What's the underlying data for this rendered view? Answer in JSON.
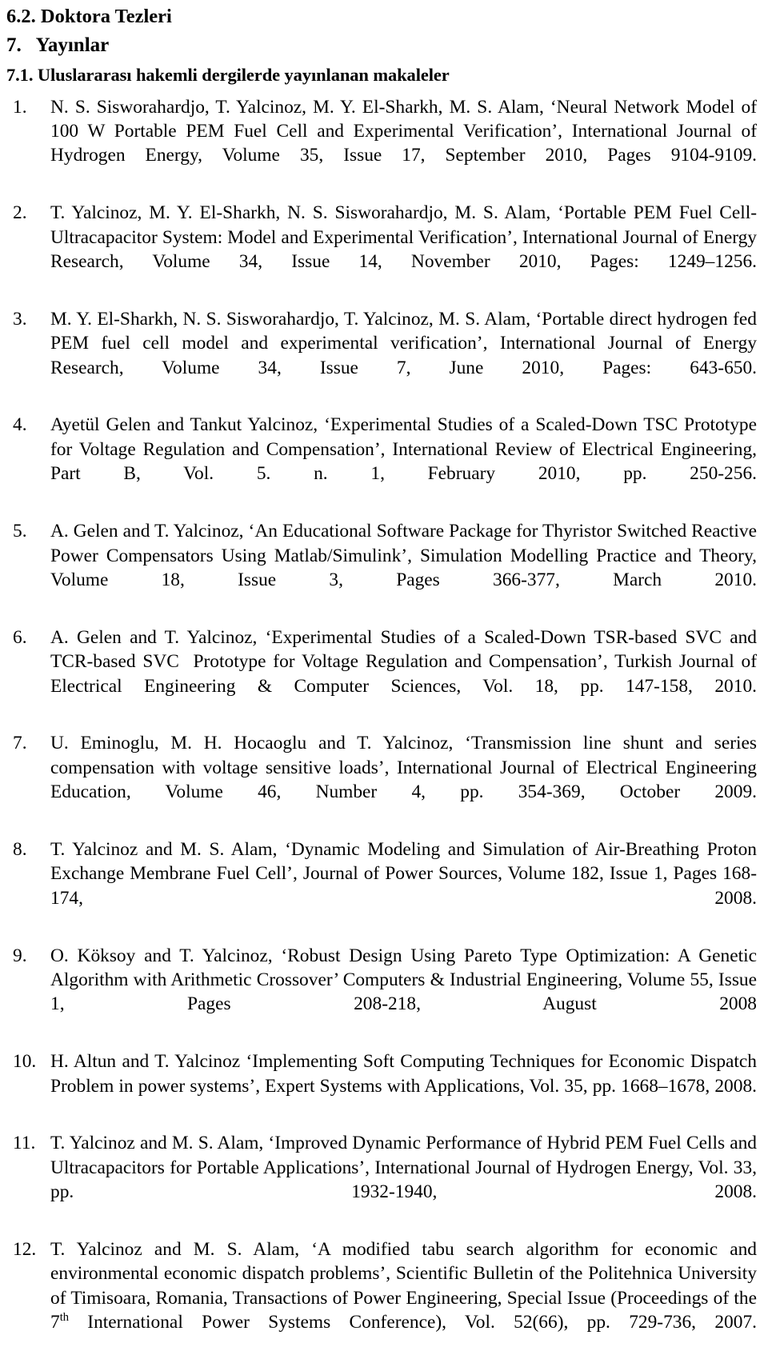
{
  "document": {
    "headings": {
      "section_6_2": "6.2. Doktora Tezleri",
      "section_7": "7.   Yayınlar",
      "section_7_1": "7.1. Uluslararası hakemli dergilerde yayınlanan makaleler"
    },
    "references": [
      {
        "number": "1.",
        "text": "N. S. Sisworahardjo, T. Yalcinoz, M. Y. El-Sharkh, M. S. Alam, ‘Neural Network Model of 100 W Portable PEM Fuel Cell and Experimental Verification’, International Journal of Hydrogen Energy, Volume 35, Issue 17, September 2010, Pages 9104-9109."
      },
      {
        "number": "2.",
        "text": "T. Yalcinoz, M. Y. El-Sharkh, N. S. Sisworahardjo, M. S. Alam, ‘Portable PEM Fuel Cell-Ultracapacitor System: Model and Experimental Verification’, International Journal of Energy Research, Volume 34, Issue 14, November 2010, Pages: 1249–1256."
      },
      {
        "number": "3.",
        "text": "M. Y. El-Sharkh, N. S. Sisworahardjo, T. Yalcinoz, M. S. Alam, ‘Portable direct hydrogen fed PEM fuel cell model and experimental verification’, International Journal of Energy Research, Volume 34, Issue 7, June 2010, Pages: 643-650."
      },
      {
        "number": "4.",
        "text": "Ayetül Gelen and Tankut Yalcinoz, ‘Experimental Studies of a Scaled-Down TSC Prototype for Voltage Regulation and Compensation’, International Review of Electrical Engineering, Part B, Vol. 5. n. 1, February 2010, pp. 250-256."
      },
      {
        "number": "5.",
        "text": "A. Gelen and T. Yalcinoz, ‘An Educational Software Package for Thyristor Switched Reactive Power Compensators Using Matlab/Simulink’, Simulation Modelling Practice and Theory, Volume 18, Issue 3, Pages 366-377, March 2010."
      },
      {
        "number": "6.",
        "text": "A. Gelen and T. Yalcinoz, ‘Experimental Studies of a Scaled-Down TSR-based SVC and TCR-based SVC  Prototype for Voltage Regulation and Compensation’, Turkish Journal of Electrical Engineering & Computer Sciences, Vol. 18, pp. 147-158, 2010."
      },
      {
        "number": "7.",
        "text": "U. Eminoglu, M. H. Hocaoglu and T. Yalcinoz, ‘Transmission line shunt and series compensation with voltage sensitive loads’, International Journal of Electrical Engineering Education, Volume 46, Number 4, pp. 354-369, October 2009."
      },
      {
        "number": "8.",
        "text": "T. Yalcinoz and M. S. Alam, ‘Dynamic Modeling and Simulation of Air-Breathing Proton Exchange Membrane Fuel Cell’, Journal of Power Sources, Volume 182, Issue 1, Pages 168-174, 2008."
      },
      {
        "number": "9.",
        "text": "O. Köksoy and T. Yalcinoz, ‘Robust Design Using Pareto Type Optimization: A Genetic Algorithm with Arithmetic Crossover’ Computers & Industrial Engineering, Volume 55, Issue 1, Pages 208-218, August 2008"
      },
      {
        "number": "10.",
        "text": "H. Altun and T. Yalcinoz ‘Implementing Soft Computing Techniques for Economic Dispatch Problem in power systems’, Expert Systems with Applications, Vol. 35, pp. 1668–1678, 2008."
      },
      {
        "number": "11.",
        "text": "T. Yalcinoz and M. S. Alam, ‘Improved Dynamic Performance of Hybrid PEM Fuel Cells and Ultracapacitors for Portable Applications’, International Journal of Hydrogen Energy, Vol. 33, pp. 1932-1940, 2008."
      },
      {
        "number": "12.",
        "text_before_sup": "T. Yalcinoz and M. S. Alam, ‘A modified tabu search algorithm for economic and environmental economic dispatch problems’, Scientific Bulletin of the Politehnica University of Timisoara, Romania, Transactions of Power Engineering, Special Issue (Proceedings of the 7",
        "superscript": "th",
        "text_after_sup": " International Power Systems Conference), Vol. 52(66), pp. 729-736, 2007."
      }
    ]
  }
}
